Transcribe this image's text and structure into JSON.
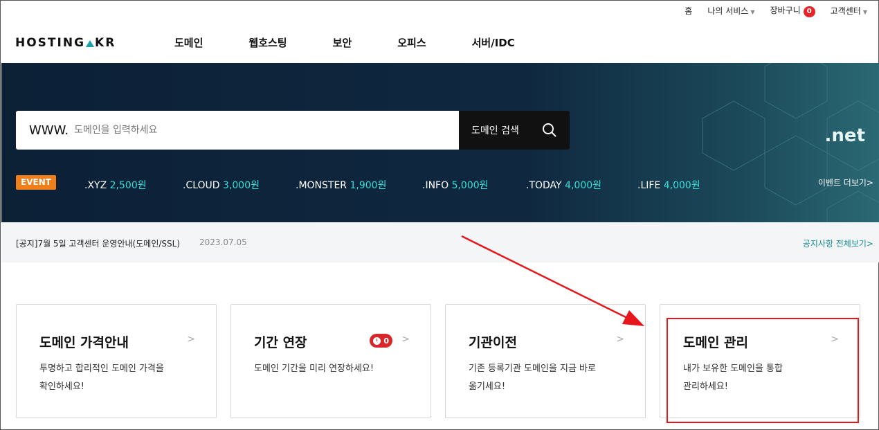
{
  "util_nav": {
    "home": "홈",
    "my_services": "나의 서비스",
    "cart": "장바구니",
    "cart_count": "0",
    "support": "고객센터"
  },
  "logo": {
    "text_left": "HOSTING",
    "text_right": "KR",
    "accent": "#1aa3a8"
  },
  "gnb": [
    "도메인",
    "웹호스팅",
    "보안",
    "오피스",
    "서버/IDC"
  ],
  "search": {
    "prefix": "WWW.",
    "placeholder": "도메인을 입력하세요",
    "button": "도메인 검색"
  },
  "event": {
    "tag": "EVENT",
    "tlds": [
      {
        "name": ".XYZ",
        "price": "2,500원"
      },
      {
        "name": ".CLOUD",
        "price": "3,000원"
      },
      {
        "name": ".MONSTER",
        "price": "1,900원"
      },
      {
        "name": ".INFO",
        "price": "5,000원"
      },
      {
        "name": ".TODAY",
        "price": "4,000원"
      },
      {
        "name": ".LIFE",
        "price": "4,000원"
      }
    ],
    "banner_tld": ".net",
    "more": "이벤트 더보기>"
  },
  "notice": {
    "text": "[공지]7월 5일 고객센터 운영안내(도메인/SSL)",
    "date": "2023.07.05",
    "all": "공지사항 전체보기>"
  },
  "cards": [
    {
      "title": "도메인 가격안내",
      "desc": "투명하고 합리적인 도메인 가격을\n확인하세요!"
    },
    {
      "title": "기간 연장",
      "desc": "도메인 기간을 미리 연장하세요!",
      "count": "0"
    },
    {
      "title": "기관이전",
      "desc": "기존 등록기관 도메인을 지금 바로\n옮기세요!"
    },
    {
      "title": "도메인 관리",
      "desc": "내가 보유한 도메인을 통합\n관리하세요!"
    }
  ],
  "colors": {
    "hero_bg": "#0c2036",
    "event": "#f07f1a",
    "price": "#35e0d8",
    "annotation": "#e6161b"
  }
}
